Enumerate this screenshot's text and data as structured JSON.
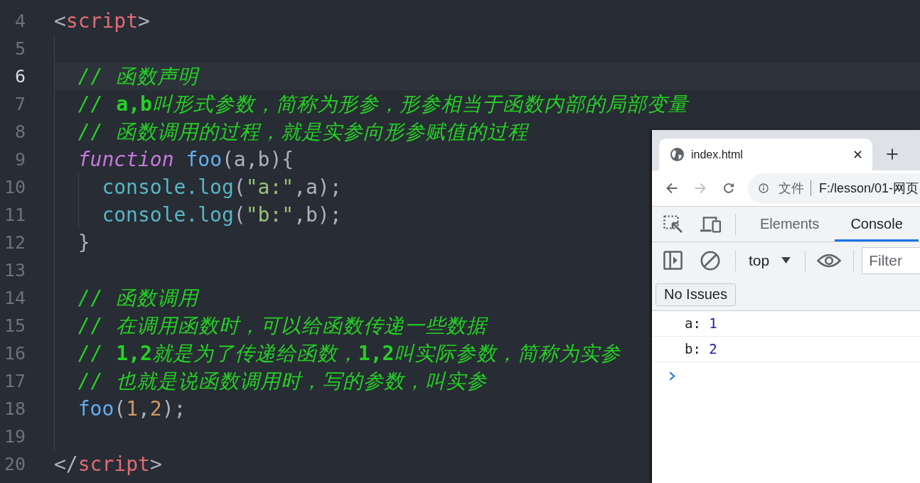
{
  "editor": {
    "lines": [
      {
        "number": "4",
        "current": false,
        "tokens": [
          {
            "kind": "punct",
            "text": "<"
          },
          {
            "kind": "tag",
            "text": "script"
          },
          {
            "kind": "punct",
            "text": ">"
          }
        ],
        "children": [
          {
            "number": "5",
            "current": false
          },
          {
            "number": "6",
            "current": true,
            "tokens": [
              {
                "kind": "comment",
                "text": "// 函数声明"
              }
            ]
          },
          {
            "number": "7",
            "current": false,
            "tokens": [
              {
                "kind": "comment",
                "text": "// **a,b**叫形式参数，简称为形参，形参相当于函数内部的局部变量"
              }
            ]
          },
          {
            "number": "8",
            "current": false,
            "tokens": [
              {
                "kind": "comment",
                "text": "// 函数调用的过程，就是实参向形参赋值的过程"
              }
            ]
          },
          {
            "number": "9",
            "current": false,
            "tokens": [
              {
                "kind": "keyword",
                "text": "function "
              },
              {
                "kind": "function",
                "text": "foo"
              },
              {
                "kind": "punct",
                "text": "(a,b){"
              }
            ],
            "children": [
              {
                "number": "10",
                "current": false,
                "tokens": [
                  {
                    "kind": "method",
                    "text": "console.log"
                  },
                  {
                    "kind": "punct",
                    "text": "("
                  },
                  {
                    "kind": "string",
                    "text": "\"a:\""
                  },
                  {
                    "kind": "punct",
                    "text": ",a);"
                  }
                ]
              },
              {
                "number": "11",
                "current": false,
                "tokens": [
                  {
                    "kind": "method",
                    "text": "console.log"
                  },
                  {
                    "kind": "punct",
                    "text": "("
                  },
                  {
                    "kind": "string",
                    "text": "\"b:\""
                  },
                  {
                    "kind": "punct",
                    "text": ",b);"
                  }
                ]
              }
            ]
          },
          {
            "number": "12",
            "current": false,
            "tokens": [
              {
                "kind": "punct",
                "text": "}"
              }
            ]
          },
          {
            "number": "13",
            "current": false
          },
          {
            "number": "14",
            "current": false,
            "tokens": [
              {
                "kind": "comment",
                "text": "// 函数调用"
              }
            ]
          },
          {
            "number": "15",
            "current": false,
            "tokens": [
              {
                "kind": "comment",
                "text": "// 在调用函数时，可以给函数传递一些数据"
              }
            ]
          },
          {
            "number": "16",
            "current": false,
            "tokens": [
              {
                "kind": "comment",
                "text": "// **1,2**就是为了传递给函数，**1,2**叫实际参数，简称为实参"
              }
            ]
          },
          {
            "number": "17",
            "current": false,
            "tokens": [
              {
                "kind": "comment",
                "text": "// 也就是说函数调用时，写的参数，叫实参"
              }
            ]
          },
          {
            "number": "18",
            "current": false,
            "tokens": [
              {
                "kind": "function",
                "text": "foo"
              },
              {
                "kind": "punct",
                "text": "("
              },
              {
                "kind": "number",
                "text": "1"
              },
              {
                "kind": "punct",
                "text": ","
              },
              {
                "kind": "number",
                "text": "2"
              },
              {
                "kind": "punct",
                "text": ");"
              }
            ]
          },
          {
            "number": "19",
            "current": false
          }
        ]
      },
      {
        "number": "20",
        "current": false,
        "tokens": [
          {
            "kind": "punct",
            "text": "</"
          },
          {
            "kind": "tag",
            "text": "script"
          },
          {
            "kind": "punct",
            "text": ">"
          }
        ]
      }
    ]
  },
  "browser": {
    "tabs": [
      {
        "title": "index.html",
        "selected": true
      }
    ],
    "nav_buttons": [
      {
        "kind": "back",
        "disabled": false
      },
      {
        "kind": "forward",
        "disabled": true
      },
      {
        "kind": "reload",
        "disabled": false
      }
    ],
    "address": {
      "scheme_label": "文件",
      "url": "F:/lesson/01-网页"
    },
    "devtools": {
      "tabs": [
        {
          "label": "Elements",
          "selected": false
        },
        {
          "label": "Console",
          "selected": true
        }
      ],
      "context": "top",
      "filter": {
        "placeholder": "Filter"
      },
      "issues_button": "No Issues",
      "messages": [
        {
          "label": "a:",
          "value": "1"
        },
        {
          "label": "b:",
          "value": "2"
        }
      ]
    }
  }
}
